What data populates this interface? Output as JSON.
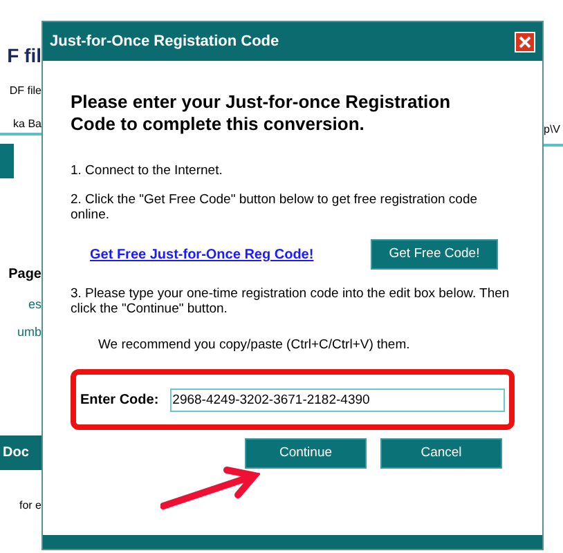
{
  "background": {
    "left": [
      {
        "kind": "heading",
        "text": "F fil"
      },
      {
        "kind": "text",
        "text": "DF file"
      },
      {
        "kind": "field",
        "text": "ka Ba"
      },
      {
        "kind": "button"
      },
      {
        "kind": "heading2",
        "text": "Page"
      },
      {
        "kind": "link",
        "text": "es"
      },
      {
        "kind": "link",
        "text": "umb"
      },
      {
        "kind": "bar",
        "text": "Doc"
      },
      {
        "kind": "text",
        "text": "for e"
      }
    ],
    "right": [
      {
        "kind": "field",
        "text": "p\\V"
      }
    ]
  },
  "dialog": {
    "title": "Just-for-Once Registation Code",
    "heading": "Please enter your Just-for-once Registration Code to complete this conversion.",
    "step_1": "1. Connect to the Internet.",
    "step_2": "2. Click the \"Get Free Code\" button below to get free registration code online.",
    "link": "Get Free Just-for-Once Reg Code!",
    "get_code_button": "Get Free Code!",
    "step_3": "3. Please type your one-time registration code into the edit box below. Then click the \"Continue\" button.",
    "hint": "We recommend you copy/paste (Ctrl+C/Ctrl+V) them.",
    "code_label": "Enter Code:",
    "code_value": "2968-4249-3202-3671-2182-4390",
    "buttons": [
      "Continue",
      "Cancel"
    ]
  }
}
